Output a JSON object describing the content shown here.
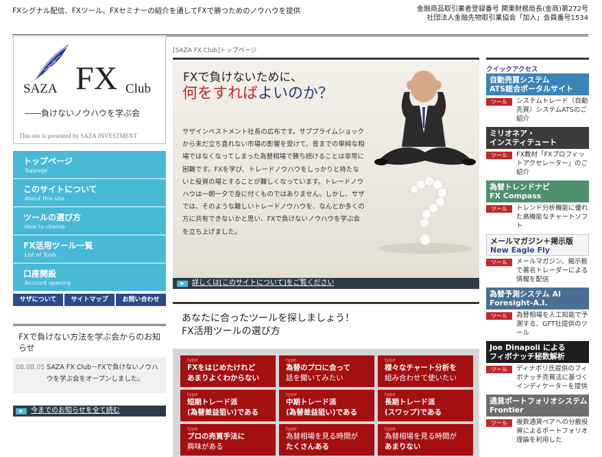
{
  "header": {
    "tagline": "FXシグナル配信、FXツール、FXセミナーの紹介を通してFXで勝つためのノウハウを提供",
    "registration_line1": "金融商品取引業者登録番号 関東財務局長(金商)第272号",
    "registration_line2": "社団法人金融先物取引業協会「加入」会員番号1534"
  },
  "logo": {
    "saza": "SAZA",
    "fx": "FX",
    "club": "Club",
    "subtitle": "――負けないノウハウを学ぶ会",
    "presented": "This site is presented by SAZA INVESTMENT"
  },
  "nav": [
    {
      "label": "トップページ",
      "sub": "Toppage"
    },
    {
      "label": "このサイトについて",
      "sub": "About this site"
    },
    {
      "label": "ツールの選び方",
      "sub": "How to choose"
    },
    {
      "label": "FX活用ツール一覧",
      "sub": "List of Tools"
    },
    {
      "label": "口座開設",
      "sub": "Account opening"
    }
  ],
  "subnav": [
    "サザについて",
    "サイトマップ",
    "お問い合わせ"
  ],
  "news": {
    "title": "FXで負けない方法を学ぶ会からのお知らせ",
    "date": "08.08.05",
    "text": "SAZA FX Club－FXで負けないノウハウを学ぶ会をオープンしました。",
    "more": "今までのお知らせを全て読む",
    "arrow": "▶"
  },
  "breadcrumb": "[SAZA FX Club]トップページ",
  "hero": {
    "heading1": "FXで負けないために、",
    "heading2_red": "何をすれば",
    "heading2_rest": "よいのか？",
    "body": "サザインベストメント社長の広布です。サブプライムショックから未だ立ち直れない市場の影響を受けて、昔までの単純な相場ではなくなってしまった為替相場で勝ち続けることは非常に困難です。FXを学び、トレードノウハウをしっかりと持たないと投資の場とすることが難しくなっています。トレードノウハウは一朝一夕で身に付くものではありません。しかし、サザでは、そのような難しいトレードノウハウを、なんとか多くの方に共有できないかと思い、FXで負けないノウハウを学ぶ会を立ち上げました。",
    "footer_link": "詳しくは[このサイトについて]をご覧ください"
  },
  "tools": {
    "title1": "あなたに合ったツールを探しましょう！",
    "title2": "FX活用ツールの選び方",
    "type_label": "type",
    "items": [
      {
        "l1": "FXをはじめたけれど",
        "l2": "あまりよくわからない",
        "b1": true,
        "b2": true
      },
      {
        "l1": "為替のプロに会って",
        "l2": "話を聞いてみたい",
        "b1": true,
        "b2": false
      },
      {
        "l1": "様々なチャート分析を",
        "l2": "組み合わせて使いたい",
        "b1": true,
        "b2": false
      },
      {
        "l1": "短期トレード派",
        "l2": "(為替差益狙い)である",
        "b1": true,
        "b2": true
      },
      {
        "l1": "中期トレード派",
        "l2": "(為替差益狙い)である",
        "b1": true,
        "b2": true
      },
      {
        "l1": "長期トレード派",
        "l2": "(スワップ)である",
        "b1": true,
        "b2": true
      },
      {
        "l1": "プロの売買手法に",
        "l2": "興味がある",
        "b1": true,
        "b2": false
      },
      {
        "l1": "為替相場を見る時間が",
        "l2": "たくさんある",
        "b1": false,
        "b2": true
      },
      {
        "l1": "為替相場を見る時間が",
        "l2": "あまりない",
        "b1": false,
        "b2": true
      }
    ]
  },
  "quick_access": {
    "title": "クイックアクセス",
    "tag": "ツール",
    "items": [
      {
        "b1": "自動売買システム",
        "b2": "ATS総合ポータルサイト",
        "bg": "#3a84b8",
        "desc": "システムトレード（自動売買）システムATSのご紹介"
      },
      {
        "b1": "ミリオネア・",
        "b2": "インスティテュート",
        "bg": "#3b3b3b",
        "desc": "FX教材「FXプロフィットアクセレーター」のご紹介"
      },
      {
        "b1": "為替トレンドナビ",
        "b2": "FX Compass",
        "bg": "#4f8f6e",
        "desc": "トレンド分析機能に優れた高機能なチャートソフト"
      },
      {
        "b1": "メールマガジン＋掲示版",
        "b2": "New Eagle Fly",
        "bg": "#f4f4f4",
        "desc": "メールマガジン、掲示板で著名トレーダーによる情報を配信"
      },
      {
        "b1": "為替予測システム AI",
        "b2": "Foresight-A.I.",
        "bg": "#4a6f93",
        "desc": "為替相場を人工知能で予測する、GFT社提供のツール"
      },
      {
        "b1": "Joe Dinapoli による",
        "b2": "フィボナッチ秘数解析",
        "bg": "#1e1e1e",
        "desc": "ディナポリ氏提供のフィボナッチ売買法に基づくインディケーターを提供"
      },
      {
        "b1": "通貨ポートフォリオシステム",
        "b2": "Frontier",
        "bg": "#6e6e6e",
        "desc": "複数通貨ペアへの分散投資によるポートフォリオ理論を利用した"
      }
    ]
  }
}
